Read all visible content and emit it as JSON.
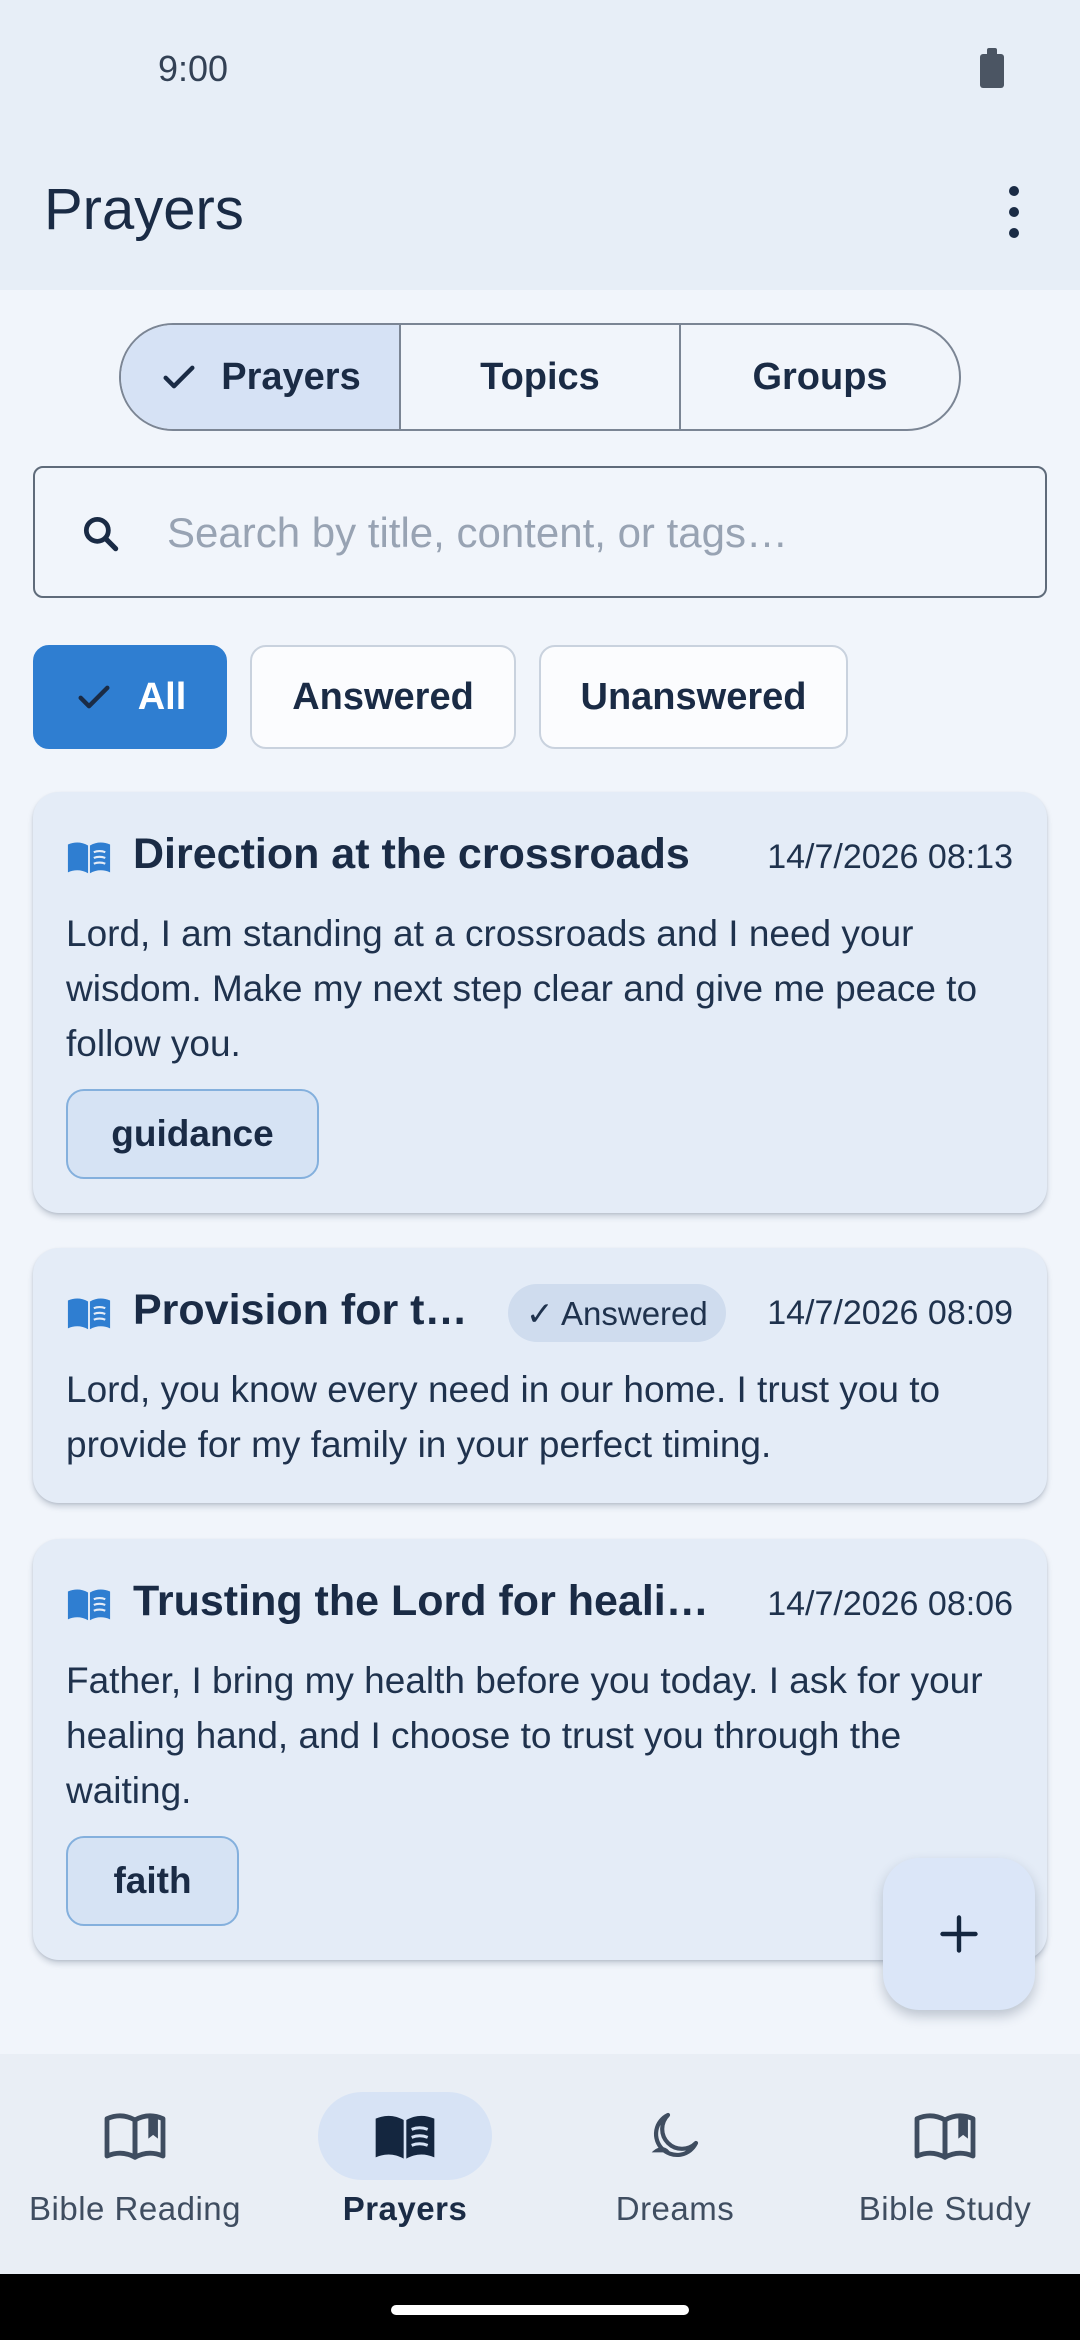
{
  "status_bar": {
    "time": "9:00",
    "battery_icon": "battery-icon"
  },
  "app_bar": {
    "title": "Prayers",
    "menu_icon": "more-vert-icon"
  },
  "segments": [
    {
      "label": "Prayers",
      "selected": true
    },
    {
      "label": "Topics",
      "selected": false
    },
    {
      "label": "Groups",
      "selected": false
    }
  ],
  "search": {
    "placeholder": "Search by title, content, or tags…",
    "value": ""
  },
  "filters": [
    {
      "label": "All",
      "selected": true
    },
    {
      "label": "Answered",
      "selected": false
    },
    {
      "label": "Unanswered",
      "selected": false
    }
  ],
  "prayers": [
    {
      "title": "Direction at the crossroads",
      "date": "14/7/2026 08:13",
      "answered": false,
      "body": "Lord, I am standing at a crossroads and I need your wisdom. Make my next step clear and give me peace to follow you.",
      "tags": [
        "guidance"
      ]
    },
    {
      "title": "Provision for th…",
      "date": "14/7/2026 08:09",
      "answered": true,
      "answered_label": "✓ Answered",
      "body": "Lord, you know every need in our home. I trust you to provide for my family in your perfect timing.",
      "tags": []
    },
    {
      "title": "Trusting the Lord for healing",
      "date": "14/7/2026 08:06",
      "answered": false,
      "body": "Father, I bring my health before you today. I ask for your healing hand, and I choose to trust you through the waiting.",
      "tags": [
        "faith"
      ]
    }
  ],
  "fab": {
    "icon": "plus-icon"
  },
  "bottom_nav": [
    {
      "label": "Bible Reading",
      "icon": "open-book-outline-icon",
      "active": false
    },
    {
      "label": "Prayers",
      "icon": "open-book-filled-icon",
      "active": true
    },
    {
      "label": "Dreams",
      "icon": "moon-icon",
      "active": false
    },
    {
      "label": "Bible Study",
      "icon": "open-book-outline-icon",
      "active": false
    }
  ],
  "colors": {
    "accent": "#2f7ed1",
    "background": "#f1f5fb",
    "card": "#e4ecf7",
    "app_bar": "#e7eef7"
  }
}
